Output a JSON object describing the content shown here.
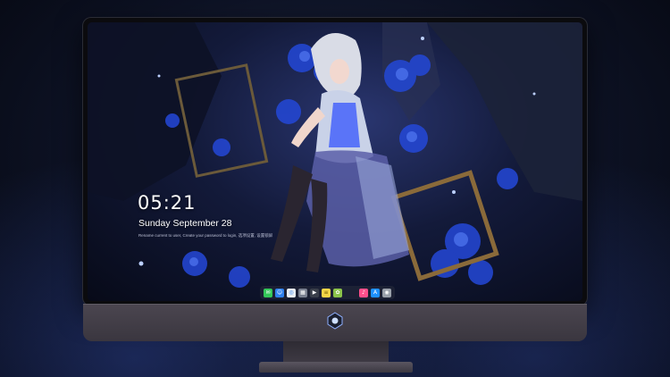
{
  "lockscreen": {
    "time": "05:21",
    "date": "Sunday September  28",
    "notice": "Rename current to user, Create your password to login, 选项设置, 设置锁屏"
  },
  "dock": {
    "apps": [
      {
        "name": "messages-icon",
        "glyph": "✉",
        "color": "#34c759"
      },
      {
        "name": "finder-icon",
        "glyph": "☺",
        "color": "#2f80ed"
      },
      {
        "name": "safari-icon",
        "glyph": "◎",
        "color": "#e9eef5"
      },
      {
        "name": "launchpad-icon",
        "glyph": "▦",
        "color": "#7a8090"
      },
      {
        "name": "video-icon",
        "glyph": "▶",
        "color": "#3a3f4a"
      },
      {
        "name": "notes-icon",
        "glyph": "≡",
        "color": "#f5d547"
      },
      {
        "name": "photos-icon",
        "glyph": "✿",
        "color": "#8bc34a"
      },
      {
        "name": "music-icon",
        "glyph": "♪",
        "color": "#ff4f8b"
      },
      {
        "name": "appstore-icon",
        "glyph": "A",
        "color": "#1e90ff"
      },
      {
        "name": "camera-icon",
        "glyph": "◉",
        "color": "#9aa0aa"
      }
    ]
  },
  "colors": {
    "screen_accent": "#2b4cff",
    "monitor_chin": "#47424c"
  }
}
